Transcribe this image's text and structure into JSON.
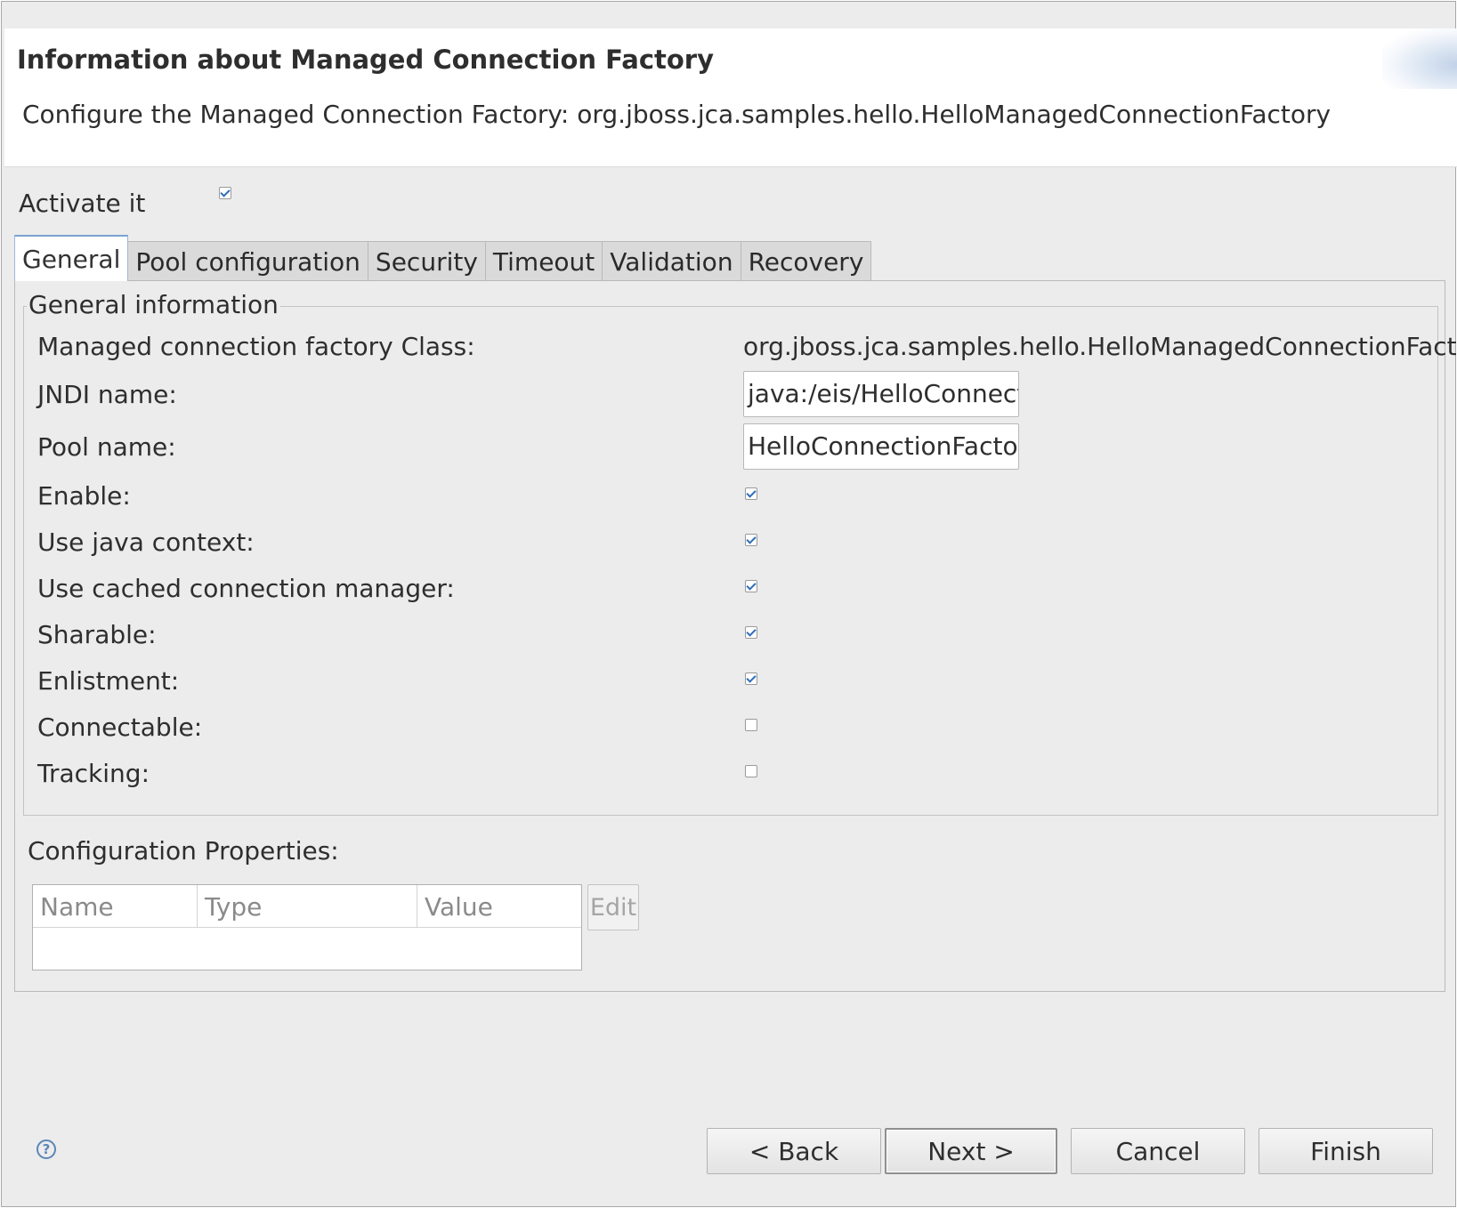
{
  "header": {
    "title": "Information about Managed Connection Factory",
    "description": "Configure the Managed Connection Factory: org.jboss.jca.samples.hello.HelloManagedConnectionFactory"
  },
  "activate": {
    "label": "Activate it",
    "checked": true
  },
  "tabs": [
    {
      "label": "General",
      "active": true
    },
    {
      "label": "Pool configuration",
      "active": false
    },
    {
      "label": "Security",
      "active": false
    },
    {
      "label": "Timeout",
      "active": false
    },
    {
      "label": "Validation",
      "active": false
    },
    {
      "label": "Recovery",
      "active": false
    }
  ],
  "general": {
    "group_title": "General information",
    "class_label": "Managed connection factory Class:",
    "class_value": "org.jboss.jca.samples.hello.HelloManagedConnectionFactory",
    "jndi_label": "JNDI name:",
    "jndi_value": "java:/eis/HelloConnectionFactory",
    "pool_label": "Pool name:",
    "pool_value": "HelloConnectionFactory",
    "checkboxes": [
      {
        "label": "Enable:",
        "checked": true
      },
      {
        "label": "Use java context:",
        "checked": true
      },
      {
        "label": "Use cached connection manager:",
        "checked": true
      },
      {
        "label": "Sharable:",
        "checked": true
      },
      {
        "label": "Enlistment:",
        "checked": true
      },
      {
        "label": "Connectable:",
        "checked": false
      },
      {
        "label": "Tracking:",
        "checked": false
      }
    ]
  },
  "config": {
    "label": "Configuration Properties:",
    "columns": [
      "Name",
      "Type",
      "Value"
    ],
    "edit_label": "Edit"
  },
  "footer": {
    "help_glyph": "?",
    "back_label": "< Back",
    "next_label": "Next >",
    "cancel_label": "Cancel",
    "finish_label": "Finish"
  }
}
